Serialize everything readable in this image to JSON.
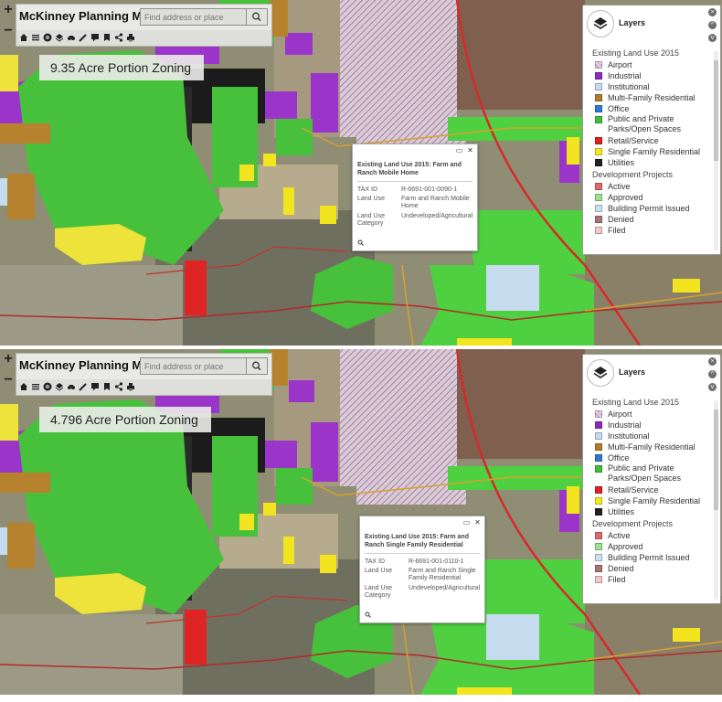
{
  "app": {
    "title": "McKinney Planning Map",
    "search_placeholder": "Find address or place",
    "zoom_in": "+",
    "zoom_out": "−"
  },
  "layers_panel": {
    "title": "Layers",
    "section_land_use": "Existing Land Use 2015",
    "land_use_items": [
      {
        "label": "Airport",
        "color": "#efe3ef"
      },
      {
        "label": "Industrial",
        "color": "#8e2ac0"
      },
      {
        "label": "Institutional",
        "color": "#c4dcf2"
      },
      {
        "label": "Multi-Family Residential",
        "color": "#b37c2a"
      },
      {
        "label": "Office",
        "color": "#2f79d8"
      },
      {
        "label": "Public and Private Parks/Open Spaces",
        "color": "#3fbf3a"
      },
      {
        "label": "Retail/Service",
        "color": "#e02020"
      },
      {
        "label": "Single Family Residential",
        "color": "#f5ea1e"
      },
      {
        "label": "Utilities",
        "color": "#222222"
      }
    ],
    "section_projects": "Development Projects",
    "project_items": [
      {
        "label": "Active",
        "color": "#e06a6a"
      },
      {
        "label": "Approved",
        "color": "#9ee08f"
      },
      {
        "label": "Building Permit Issued",
        "color": "#cde0f2"
      },
      {
        "label": "Denied",
        "color": "#a97575"
      },
      {
        "label": "Filed",
        "color": "#f3c8c8"
      }
    ]
  },
  "panels": [
    {
      "caption": "9.35 Acre Portion Zoning",
      "popup": {
        "title": "Existing Land Use 2015: Farm and Ranch Mobile Home",
        "tax_id_label": "TAX ID",
        "tax_id": "R-6691-001-0090-1",
        "land_use_label": "Land Use",
        "land_use": "Farm and Ranch Mobile Home",
        "category_label": "Land Use Category",
        "category": "Undeveloped/Agricultural"
      }
    },
    {
      "caption": "4.796 Acre Portion Zoning",
      "popup": {
        "title": "Existing Land Use 2015: Farm and Ranch Single Family Residential",
        "tax_id_label": "TAX ID",
        "tax_id": "R-6691-001-0110-1",
        "land_use_label": "Land Use",
        "land_use": "Farm and Ranch Single Family Residential",
        "category_label": "Land Use Category",
        "category": "Undeveloped/Agricultural"
      }
    }
  ],
  "icons": [
    "home-icon",
    "list-icon",
    "basemap-icon",
    "layers-icon",
    "measure-icon",
    "draw-icon",
    "comment-icon",
    "bookmark-icon",
    "share-icon",
    "print-icon",
    "search-icon",
    "maximize-icon",
    "close-icon"
  ]
}
